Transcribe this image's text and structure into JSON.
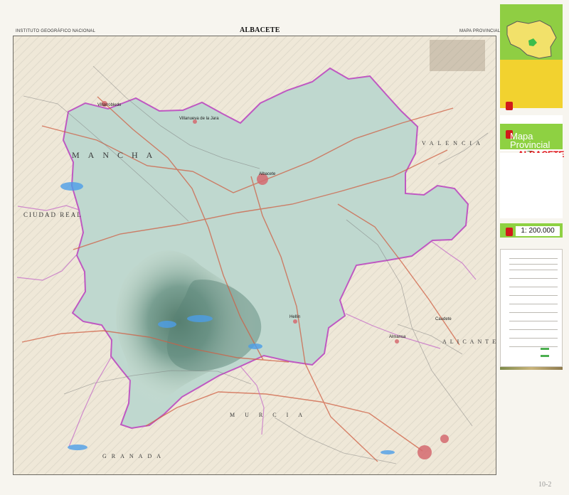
{
  "header": {
    "left_label": "INSTITUTO GEOGRÁFICO NACIONAL",
    "title": "ALBACETE",
    "right_label": "MAPA PROVINCIAL"
  },
  "map": {
    "region_labels": [
      "MANCHA",
      "CIUDAD REAL",
      "VALENCIA",
      "ALICANTE",
      "MURCIA",
      "GRANADA"
    ],
    "places": [
      "Villarrobledo",
      "Albacete",
      "Hellín",
      "Almansa",
      "Caudete",
      "Villanueva de la Jara"
    ]
  },
  "sidebar": {
    "title_top": "Mapa",
    "title_bottom": "Provincial",
    "province": "ALBACETE",
    "scale": "1: 200.000"
  },
  "footer": {
    "stamp": "10-2"
  },
  "colors": {
    "accent_green": "#8ed142",
    "accent_yellow": "#f2d22f",
    "accent_red": "#e20f18"
  }
}
